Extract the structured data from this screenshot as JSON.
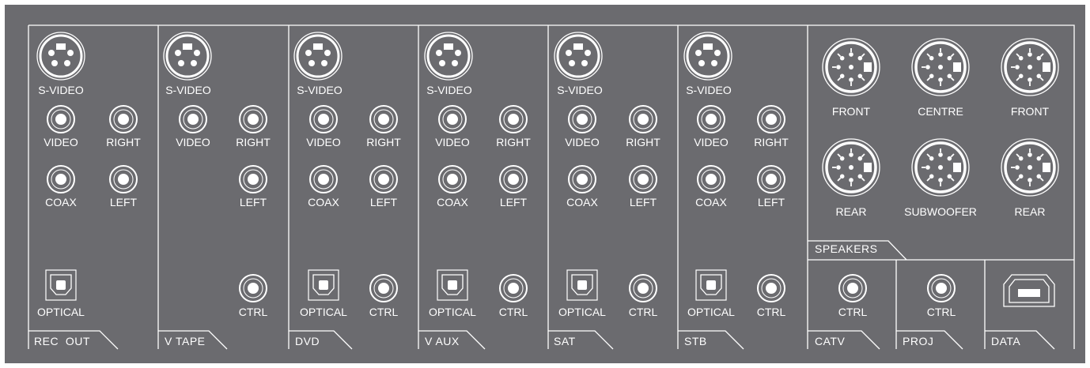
{
  "title": "",
  "colors": {
    "panel": "#6b6b6f",
    "line": "#ffffff",
    "background": "#ffffff"
  },
  "labels": {
    "svideo": "S-VIDEO",
    "video": "VIDEO",
    "right": "RIGHT",
    "coax": "COAX",
    "left": "LEFT",
    "optical": "OPTICAL",
    "ctrl": "CTRL"
  },
  "sections": [
    {
      "name": "REC  OUT"
    },
    {
      "name": "V TAPE"
    },
    {
      "name": "DVD"
    },
    {
      "name": "V AUX"
    },
    {
      "name": "SAT"
    },
    {
      "name": "STB"
    }
  ],
  "speakers": {
    "tag": "SPEAKERS",
    "row1": [
      "FRONT",
      "CENTRE",
      "FRONT"
    ],
    "row2": [
      "REAR",
      "SUBWOOFER",
      "REAR"
    ]
  },
  "bottom_boxes": [
    {
      "name": "CATV",
      "connector": "CTRL"
    },
    {
      "name": "PROJ",
      "connector": "CTRL"
    },
    {
      "name": "DATA",
      "connector": ""
    }
  ],
  "icons": {
    "svideo": "svideo-connector-icon",
    "rca": "rca-jack-icon",
    "optical": "optical-port-icon",
    "speaker": "din-speaker-connector-icon",
    "usb": "usb-b-port-icon"
  }
}
